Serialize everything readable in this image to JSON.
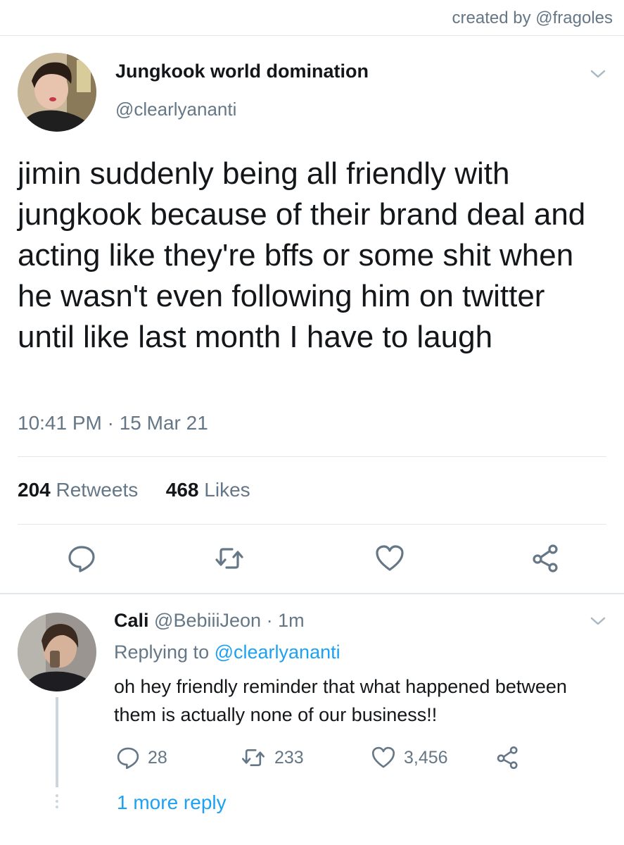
{
  "credit": "created by @fragoles",
  "main_tweet": {
    "display_name": "Jungkook world domination",
    "handle": "@clearlyananti",
    "text": "jimin suddenly being all friendly with jungkook because of their brand deal and acting like they're bffs or some shit when he wasn't even following him on twitter until like last month I have to laugh",
    "timestamp": "10:41 PM · 15 Mar 21",
    "retweets_count": "204",
    "retweets_label": "Retweets",
    "likes_count": "468",
    "likes_label": "Likes",
    "actions": [
      "reply-icon",
      "retweet-icon",
      "like-icon",
      "share-icon"
    ]
  },
  "reply": {
    "display_name": "Cali",
    "handle": "@BebiiiJeon",
    "separator": "·",
    "time_ago": "1m",
    "replying_prefix": "Replying to",
    "replying_to": "@clearlyananti",
    "text": "oh hey friendly reminder that what happened between them is actually none of our business!!",
    "reply_count": "28",
    "retweet_count": "233",
    "like_count": "3,456"
  },
  "more_replies": "1 more reply",
  "colors": {
    "link": "#1da1f2",
    "secondary_text": "#657786",
    "divider": "#e1e8ed",
    "primary_text": "#14171a"
  }
}
